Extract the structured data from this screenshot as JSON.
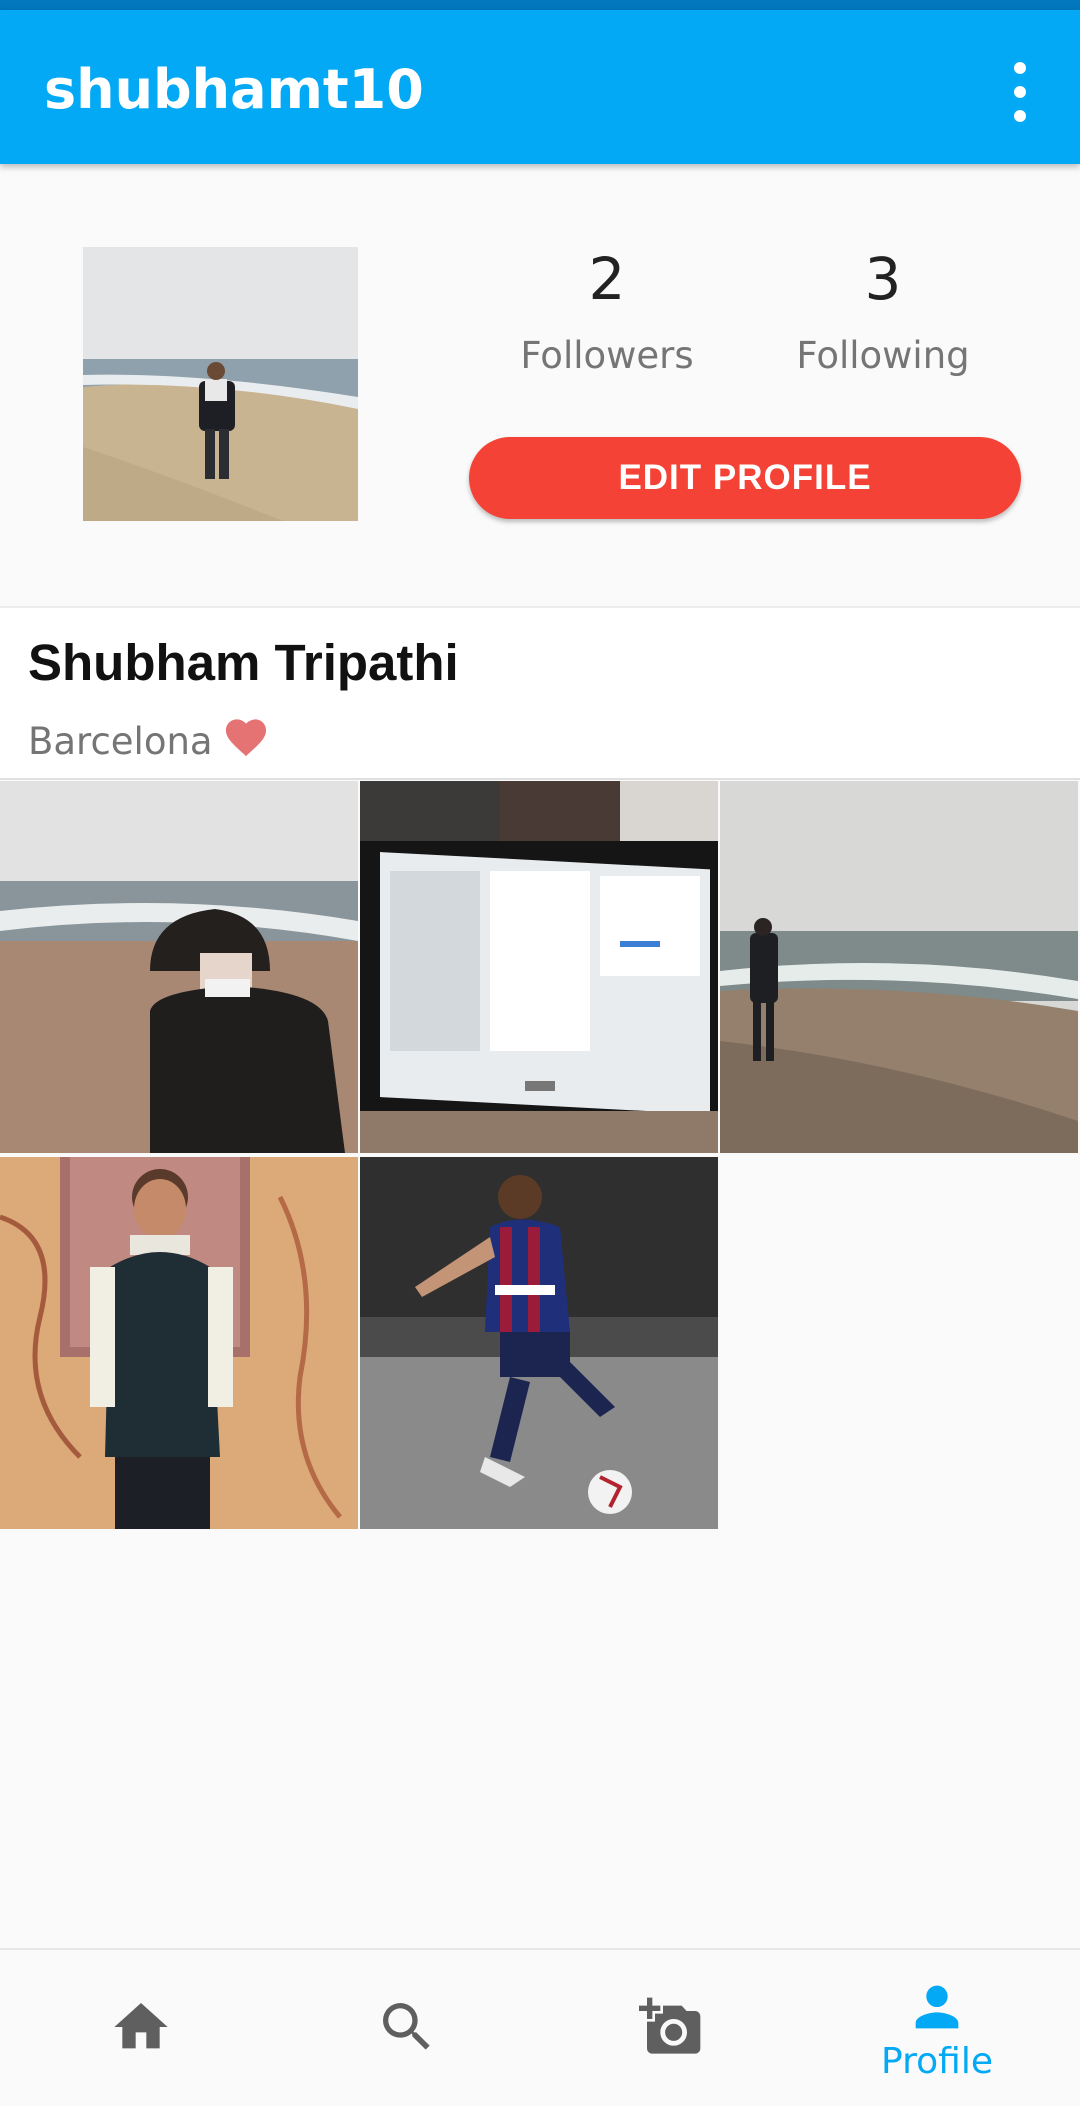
{
  "appbar": {
    "title": "shubhamt10",
    "menu_icon": "more-vert-icon"
  },
  "profile": {
    "followers_count": "2",
    "followers_label": "Followers",
    "following_count": "3",
    "following_label": "Following",
    "edit_button": "EDIT PROFILE",
    "full_name": "Shubham Tripathi",
    "bio": "Barcelona",
    "bio_icon": "heart-icon"
  },
  "posts": [
    {
      "subject": "beach-back-view"
    },
    {
      "subject": "computer-monitor"
    },
    {
      "subject": "beach-standing"
    },
    {
      "subject": "portrait-marble-wall"
    },
    {
      "subject": "footballer-kicking-ball"
    }
  ],
  "bottom_nav": {
    "items": [
      {
        "icon": "home-icon",
        "label": ""
      },
      {
        "icon": "search-icon",
        "label": ""
      },
      {
        "icon": "add-photo-icon",
        "label": ""
      },
      {
        "icon": "person-icon",
        "label": "Profile",
        "active": true
      }
    ]
  },
  "colors": {
    "primary": "#03a9f4",
    "status_bar": "#0277bd",
    "accent_button": "#f44336",
    "heart": "#e57373"
  }
}
